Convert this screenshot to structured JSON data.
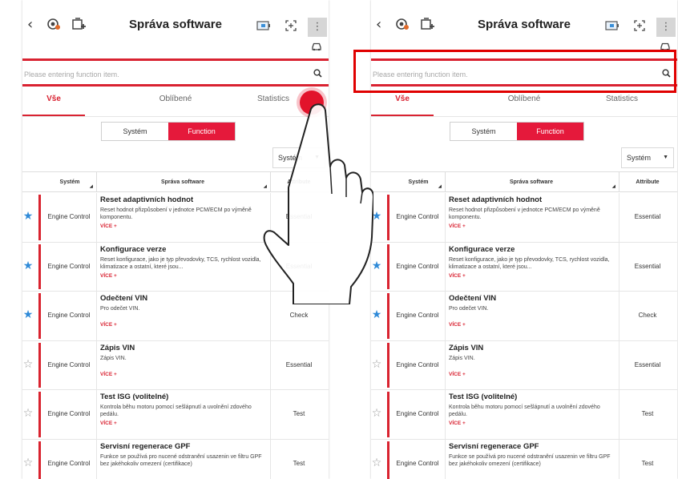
{
  "app": {
    "title": "Správa software",
    "back_glyph": "‹",
    "menu_glyph": "⋮"
  },
  "icons": [
    "back-icon",
    "diagnosis-icon",
    "add-icon",
    "battery-icon",
    "expand-icon",
    "menu-icon",
    "car-icon",
    "search-icon",
    "star-icon",
    "hand-pointer-icon"
  ],
  "search": {
    "placeholder": "Please entering function item."
  },
  "tabs": [
    {
      "label": "Vše",
      "active": true
    },
    {
      "label": "Oblíbené",
      "active": false
    },
    {
      "label": "Statistics",
      "active": false
    }
  ],
  "segment": {
    "options": [
      "Systém",
      "Function"
    ],
    "selected": "Function"
  },
  "filter": {
    "value": "Systém"
  },
  "table": {
    "headers": [
      "Systém",
      "Správa software",
      "Attribute"
    ],
    "more_label": "VÍCE +",
    "rows": [
      {
        "favorite": true,
        "system": "Engine Control",
        "title": "Reset adaptivních hodnot",
        "desc": "Reset hodnot přizpůsobení v jednotce PCM/ECM po výměně komponentu.",
        "attribute": "Essential"
      },
      {
        "favorite": true,
        "system": "Engine Control",
        "title": "Konfigurace verze",
        "desc": "Reset konfigurace, jako je typ převodovky, TCS, rychlost vozidla, klimatizace a ostatní, které jsou...",
        "attribute": "Essential"
      },
      {
        "favorite": true,
        "system": "Engine Control",
        "title": "Odečtení VIN",
        "desc": "Pro odečet VIN.",
        "attribute": "Check"
      },
      {
        "favorite": false,
        "system": "Engine Control",
        "title": "Zápis VIN",
        "desc": "Zápis VIN.",
        "attribute": "Essential"
      },
      {
        "favorite": false,
        "system": "Engine Control",
        "title": "Test ISG (volitelné)",
        "desc": "Kontrola běhu motoru pomocí sešlápnutí a uvolnění zdového pedálu.",
        "attribute": "Test"
      },
      {
        "favorite": false,
        "system": "Engine Control",
        "title": "Servisní regenerace GPF",
        "desc": "Funkce se používá pro nucené odstranění usazenin ve filtru GPF bez jakéhokoliv omezení (certifikace)",
        "attribute": "Test"
      }
    ]
  },
  "colors": {
    "accent": "#d92231",
    "segment_active": "#e5193b",
    "star": "#2f8ad8",
    "highlight": "#e00000"
  }
}
